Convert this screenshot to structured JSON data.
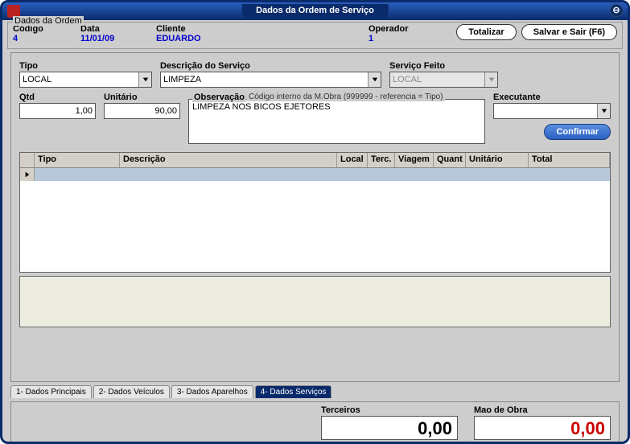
{
  "titlebar": {
    "title": "Dados da Ordem de Serviço"
  },
  "header": {
    "legend": "Dados da Ordem",
    "codigo_label": "Código",
    "codigo_value": "4",
    "data_label": "Data",
    "data_value": "11/01/09",
    "cliente_label": "Cliente",
    "cliente_value": "EDUARDO",
    "operador_label": "Operador",
    "operador_value": "1",
    "totalizar_btn": "Totalizar",
    "salvar_btn": "Salvar e Sair   (F6)"
  },
  "form": {
    "tipo_label": "Tipo",
    "tipo_value": "LOCAL",
    "descricao_label": "Descrição do Serviço",
    "descricao_value": "LIMPEZA",
    "servico_feito_label": "Serviço Feito",
    "servico_feito_value": "LOCAL",
    "qtd_label": "Qtd",
    "qtd_value": "1,00",
    "unitario_label": "Unitário",
    "unitario_value": "90,00",
    "obs_label": "Observação",
    "obs_hint": "Código interno da M.Obra (999999 - referencia = Tipo)",
    "obs_text": "LIMPEZA NOS BICOS EJETORES",
    "executante_label": "Executante",
    "executante_value": "",
    "confirmar_btn": "Confirmar"
  },
  "grid": {
    "cols": {
      "tipo": "Tipo",
      "descricao": "Descrição",
      "local": "Local",
      "terc": "Terc.",
      "viagem": "Viagem",
      "quant": "Quant",
      "unitario": "Unitário",
      "total": "Total"
    }
  },
  "tabs": {
    "t1": "1- Dados Principais",
    "t2": "2- Dados Veículos",
    "t3": "3- Dados Aparelhos",
    "t4": "4- Dados Serviços"
  },
  "footer": {
    "terceiros_label": "Terceiros",
    "terceiros_value": "0,00",
    "mao_label": "Mao de Obra",
    "mao_value": "0,00"
  }
}
